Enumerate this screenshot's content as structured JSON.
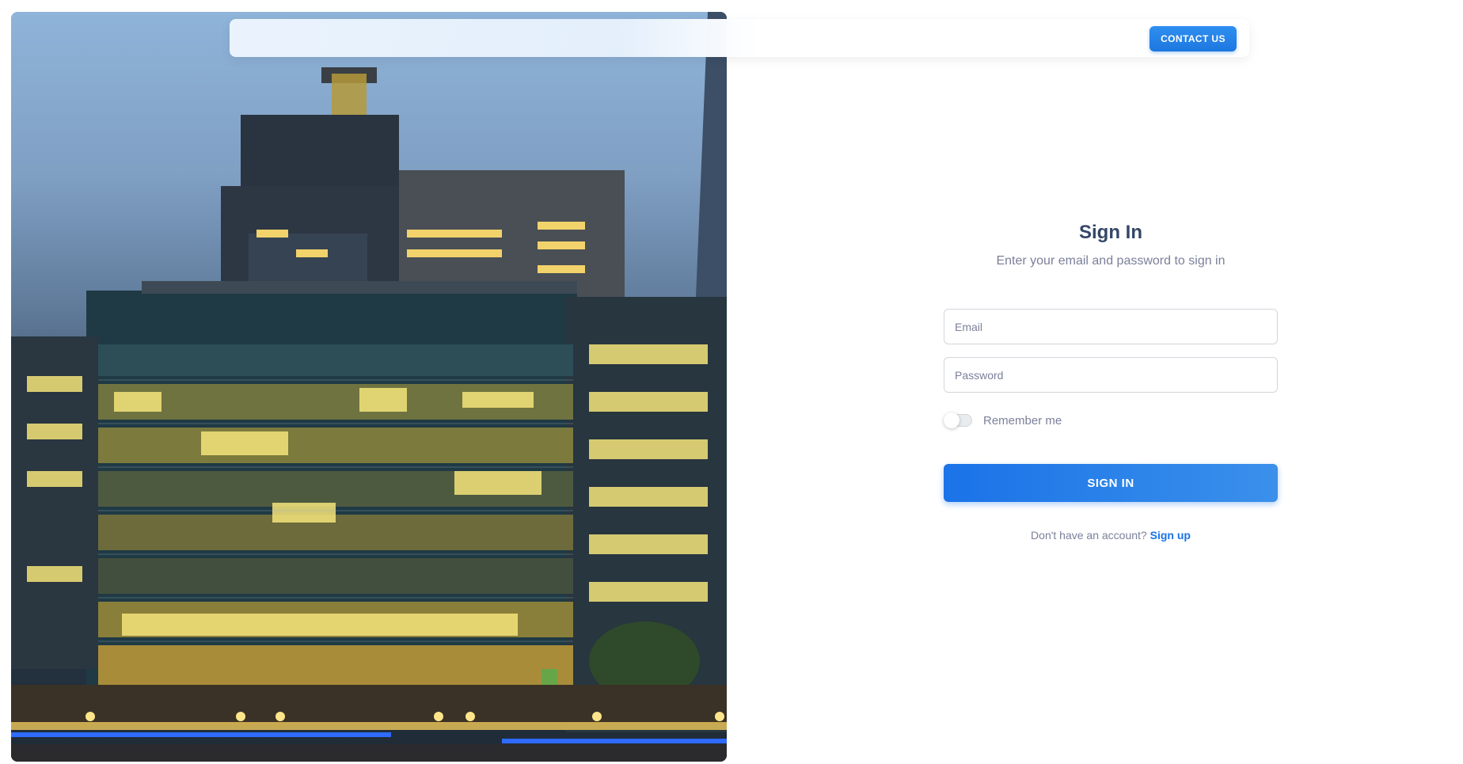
{
  "navbar": {
    "contact_label": "CONTACT US"
  },
  "hero": {
    "image": "office-building-night-photo"
  },
  "signin": {
    "title": "Sign In",
    "subtitle": "Enter your email and password to sign in",
    "email_placeholder": "Email",
    "email_value": "",
    "password_placeholder": "Password",
    "password_value": "",
    "remember_label": "Remember me",
    "remember_checked": false,
    "submit_label": "SIGN IN",
    "no_account_text": "Don't have an account?",
    "signup_label": "Sign up"
  },
  "colors": {
    "primary": "#1a73e8",
    "heading": "#344767",
    "muted": "#7b809a",
    "border": "#d2d6da"
  }
}
